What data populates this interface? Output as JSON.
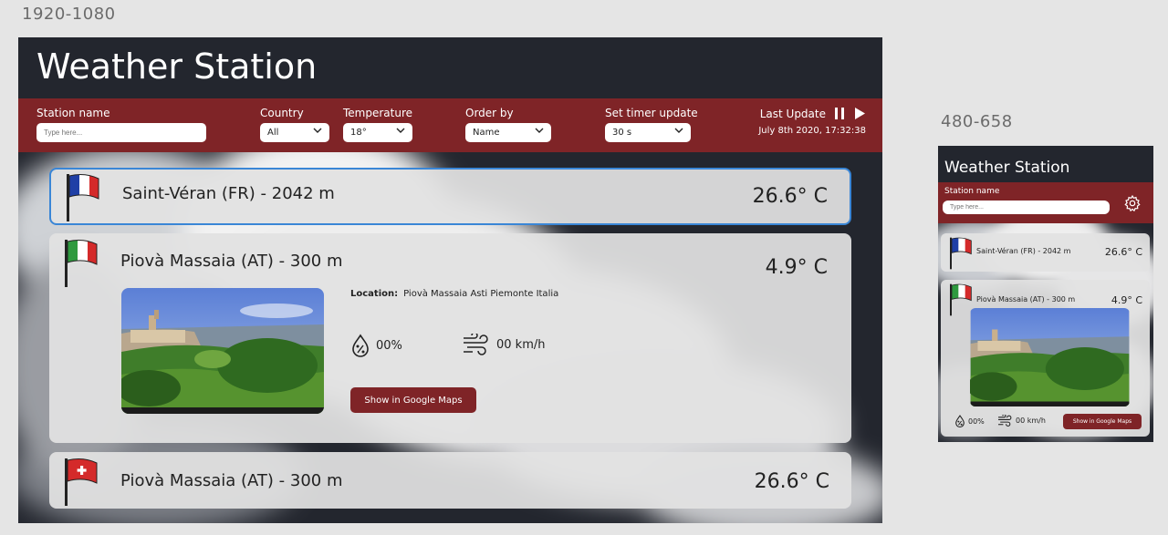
{
  "frames": {
    "desktop_label": "1920-1080",
    "mobile_label": "480-658"
  },
  "app": {
    "title": "Weather Station"
  },
  "filters": {
    "station_name": {
      "label": "Station name",
      "placeholder": "Type here..."
    },
    "country": {
      "label": "Country",
      "value": "All"
    },
    "temperature": {
      "label": "Temperature",
      "value": "18°"
    },
    "order_by": {
      "label": "Order by",
      "value": "Name"
    },
    "timer": {
      "label": "Set timer update",
      "value": "30 s"
    },
    "last_update": {
      "label": "Last Update",
      "date": "July 8th 2020, 17:32:38"
    }
  },
  "stations": [
    {
      "name": "Saint-Véran (FR) - 2042 m",
      "temp": "26.6° C",
      "flag": "france"
    },
    {
      "name": "Piovà Massaia (AT) - 300 m",
      "temp": "4.9° C",
      "flag": "italy",
      "location_label": "Location:",
      "location": "Piovà Massaia Asti Piemonte Italia",
      "humidity": "00%",
      "wind": "00 km/h",
      "maps_button": "Show in Google Maps"
    },
    {
      "name": "Piovà Massaia (AT) - 300 m",
      "temp": "26.6° C",
      "flag": "switzerland"
    }
  ],
  "mobile": {
    "stations": [
      {
        "name": "Saint-Véran (FR) - 2042 m",
        "temp": "26.6° C"
      },
      {
        "name": "Piovà Massaia (AT) - 300 m",
        "temp": "4.9° C",
        "humidity": "00%",
        "wind": "00 km/h",
        "maps_button": "Show in Google Maps"
      }
    ]
  },
  "colors": {
    "accent": "#7f2427",
    "background": "#23262e",
    "card": "#e2e2e2",
    "selection": "#3a86d6"
  },
  "icons": [
    "chevron-down-icon",
    "pause-icon",
    "play-icon",
    "humidity-icon",
    "wind-icon",
    "gear-icon",
    "flag-icon"
  ]
}
